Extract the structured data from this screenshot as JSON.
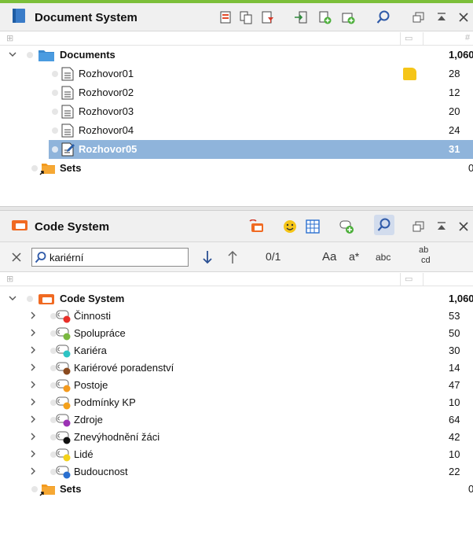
{
  "doc_panel": {
    "title": "Document System",
    "tree": {
      "root": {
        "label": "Documents",
        "count": "1,060"
      },
      "documents": [
        {
          "label": "Rozhovor01",
          "count": "28",
          "memo": true,
          "selected": false
        },
        {
          "label": "Rozhovor02",
          "count": "12",
          "memo": false,
          "selected": false
        },
        {
          "label": "Rozhovor03",
          "count": "20",
          "memo": false,
          "selected": false
        },
        {
          "label": "Rozhovor04",
          "count": "24",
          "memo": false,
          "selected": false
        },
        {
          "label": "Rozhovor05",
          "count": "31",
          "memo": false,
          "selected": true
        }
      ],
      "sets": {
        "label": "Sets",
        "count": "0"
      }
    }
  },
  "code_panel": {
    "title": "Code System",
    "search": {
      "value": "kariérní",
      "match_counter": "0/1",
      "opt_case": "Aa",
      "opt_regex": "a*",
      "opt_word": "abc",
      "opt_replace_top": "ab",
      "opt_replace_bottom": "cd"
    },
    "tree": {
      "root": {
        "label": "Code System",
        "count": "1,060"
      },
      "codes": [
        {
          "label": "Činnosti",
          "count": "53",
          "color": "#e8302a"
        },
        {
          "label": "Spolupráce",
          "count": "50",
          "color": "#7ab840"
        },
        {
          "label": "Kariéra",
          "count": "30",
          "color": "#2ec4c4"
        },
        {
          "label": "Kariérové poradenství",
          "count": "14",
          "color": "#8a4a1e"
        },
        {
          "label": "Postoje",
          "count": "47",
          "color": "#f39a1e"
        },
        {
          "label": "Podmínky KP",
          "count": "10",
          "color": "#f4a11c"
        },
        {
          "label": "Zdroje",
          "count": "64",
          "color": "#9b32b4"
        },
        {
          "label": "Znevýhodnění žáci",
          "count": "42",
          "color": "#111111"
        },
        {
          "label": "Lidé",
          "count": "10",
          "color": "#f3d11a"
        },
        {
          "label": "Budoucnost",
          "count": "22",
          "color": "#2a6fcf"
        }
      ],
      "sets": {
        "label": "Sets",
        "count": "0"
      }
    }
  },
  "colors": {
    "top_accent": "#7cbf3a",
    "selection": "#8fb4db",
    "folder_blue": "#3a8ad0",
    "code_system_orange": "#f06a22",
    "memo_yellow": "#f5c518"
  }
}
